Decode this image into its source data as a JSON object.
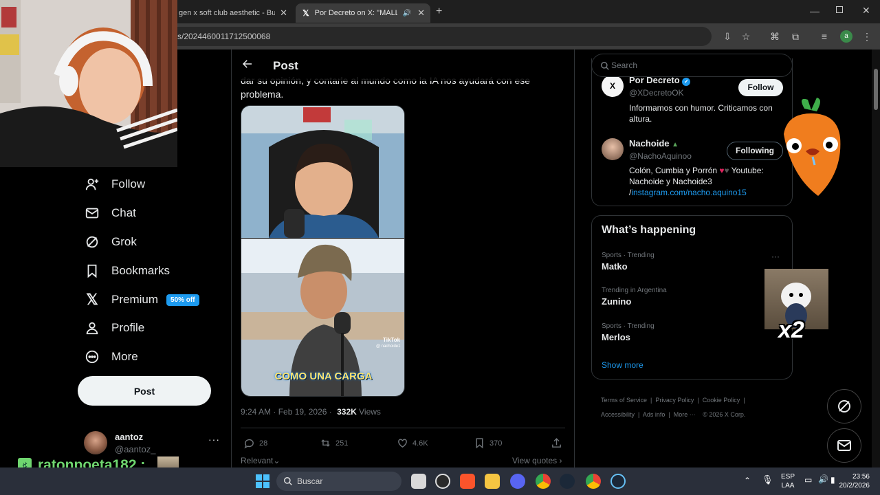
{
  "browser": {
    "tabs": [
      {
        "title": "gen x soft club aesthetic - Busc",
        "active": false
      },
      {
        "title": "Por Decreto on X: \"MALL",
        "active": true
      }
    ],
    "url": "s/2024460011712500068",
    "window_buttons": [
      "minimize",
      "maximize",
      "close"
    ]
  },
  "nav": {
    "items": [
      {
        "label": "Follow",
        "icon": "person-add-icon"
      },
      {
        "label": "Chat",
        "icon": "mail-icon"
      },
      {
        "label": "Grok",
        "icon": "grok-icon"
      },
      {
        "label": "Bookmarks",
        "icon": "bookmark-icon"
      },
      {
        "label": "Premium",
        "icon": "x-logo-icon",
        "badge": "50% off"
      },
      {
        "label": "Profile",
        "icon": "person-icon"
      },
      {
        "label": "More",
        "icon": "more-circle-icon"
      }
    ],
    "post_button": "Post",
    "account": {
      "name": "aantoz",
      "handle": "@aantoz_"
    }
  },
  "post": {
    "header": "Post",
    "text_line1": "dar su opinión, y contarle al mundo como la IA nos ayudará con ese",
    "text_line2": "problema.",
    "image_caption": "COMO UNA CARGA",
    "image_watermark": "TikTok",
    "image_watermark_user": "@ nachoide1",
    "time": "9:24 AM · Feb 19, 2026 ·",
    "views_count": "332K",
    "views_label": "Views",
    "actions": {
      "replies": "28",
      "reposts": "251",
      "likes": "4.6K",
      "bookmarks": "370"
    },
    "sort_label": "Relevant",
    "view_quotes": "View quotes"
  },
  "sidebar": {
    "search_placeholder": "Search",
    "accounts": [
      {
        "name": "Por Decreto",
        "handle": "@XDecretoOK",
        "bio": "Informamos con humor. Criticamos con altura.",
        "button": "Follow"
      },
      {
        "name": "Nachoide",
        "handle": "@NachoAquinoo",
        "bio_line1": "Colón, Cumbia y Porrón",
        "bio_line1b": "Youtube:",
        "bio_line2": "Nachoide y Nachoide3",
        "bio_line3_prefix": "/",
        "bio_link": "instagram.com/nacho.aquino15",
        "button": "Following"
      }
    ],
    "happening_title": "What’s happening",
    "trends": [
      {
        "meta": "Sports · Trending",
        "name": "Matko"
      },
      {
        "meta": "Trending in Argentina",
        "name": "Zunino"
      },
      {
        "meta": "Sports · Trending",
        "name": "Merlos"
      }
    ],
    "show_more": "Show more",
    "footer": [
      "Terms of Service",
      "Privacy Policy",
      "Cookie Policy",
      "Accessibility",
      "Ads info",
      "More ···",
      "© 2026 X Corp."
    ]
  },
  "overlay": {
    "chat_user": "ratonpoeta182 :",
    "sticker_text": "x2"
  },
  "taskbar": {
    "search_placeholder": "Buscar",
    "lang": "ESP",
    "lang2": "LAA",
    "time": "23:56",
    "date": "20/2/2026"
  },
  "colors": {
    "accent": "#1d9bf0",
    "background": "#000000",
    "border": "#2f3336",
    "muted": "#71767b"
  }
}
